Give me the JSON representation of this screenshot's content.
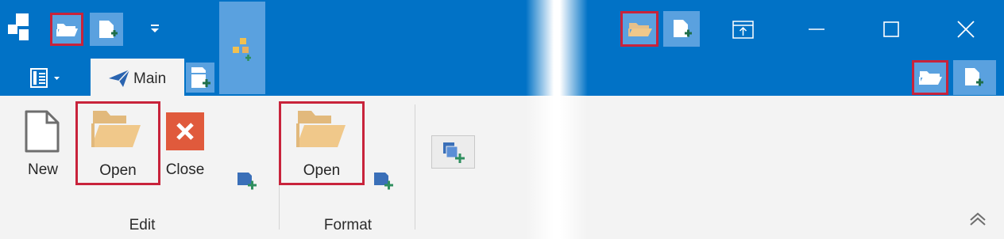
{
  "tabs": [
    {
      "label": "Main"
    }
  ],
  "groups": [
    {
      "label": "Edit",
      "buttons": [
        {
          "label": "New"
        },
        {
          "label": "Open"
        },
        {
          "label": "Close"
        }
      ]
    },
    {
      "label": "Format",
      "buttons": [
        {
          "label": "Open"
        }
      ]
    }
  ],
  "icons": {
    "app": "app-logo-icon",
    "open": "folder-open-icon",
    "add": "add-item-icon",
    "customize": "customize-toolbar-icon",
    "menu": "application-menu-icon",
    "collapse": "collapse-ribbon-icon"
  },
  "colors": {
    "header": "#0172c6",
    "button_tile": "#5aa1df",
    "highlight": "#c8233b",
    "folder": "#f0c88a",
    "close_tile": "#e05a3c",
    "ribbon": "#f3f3f3"
  }
}
